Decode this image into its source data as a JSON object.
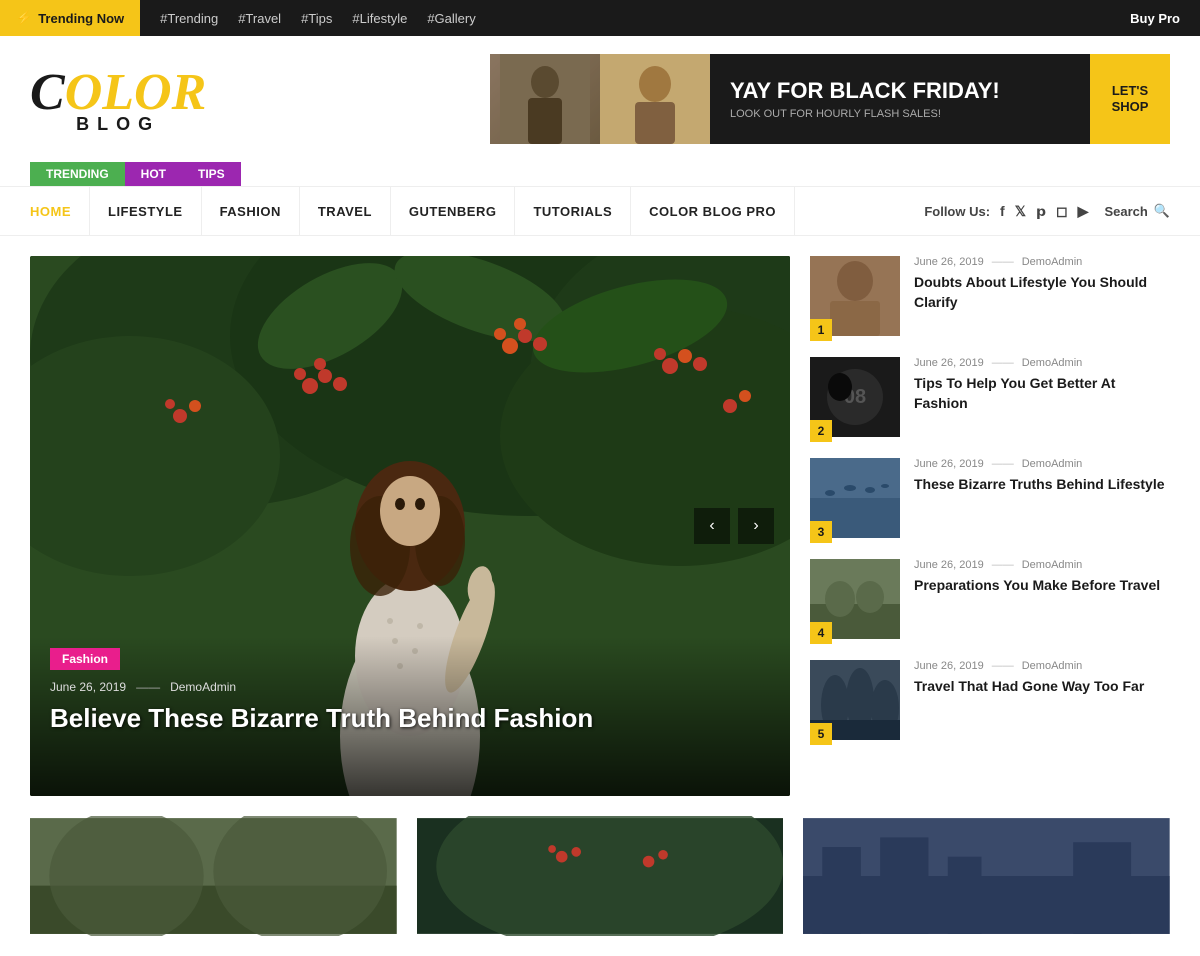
{
  "topbar": {
    "trending_label": "Trending Now",
    "bolt": "⚡",
    "nav_links": [
      {
        "label": "#Trending",
        "href": "#"
      },
      {
        "label": "#Travel",
        "href": "#"
      },
      {
        "label": "#Tips",
        "href": "#"
      },
      {
        "label": "#Lifestyle",
        "href": "#"
      },
      {
        "label": "#Gallery",
        "href": "#"
      }
    ],
    "buy_pro": "Buy Pro"
  },
  "logo": {
    "color_text": "COLOR",
    "blog_text": "BLOG"
  },
  "banner": {
    "headline": "YAY FOR BLACK FRIDAY!",
    "subtext": "LOOK OUT FOR HOURLY FLASH SALES!",
    "cta": "LET'S SHOP"
  },
  "category_tabs": [
    {
      "label": "TRENDING",
      "class": "trending"
    },
    {
      "label": "HOT",
      "class": "hot"
    },
    {
      "label": "TIPS",
      "class": "tips"
    }
  ],
  "nav": {
    "links": [
      {
        "label": "HOME",
        "active": true
      },
      {
        "label": "LIFESTYLE",
        "active": false
      },
      {
        "label": "FASHION",
        "active": false
      },
      {
        "label": "TRAVEL",
        "active": false
      },
      {
        "label": "GUTENBERG",
        "active": false
      },
      {
        "label": "TUTORIALS",
        "active": false
      },
      {
        "label": "COLOR BLOG PRO",
        "active": false
      }
    ],
    "follow_us": "Follow Us:",
    "search": "Search"
  },
  "slider": {
    "category": "Fashion",
    "date": "June 26, 2019",
    "author": "DemoAdmin",
    "title": "Believe These Bizarre Truth Behind Fashion",
    "prev": "‹",
    "next": "›"
  },
  "sidebar_items": [
    {
      "num": "1",
      "date": "June 26, 2019",
      "author": "DemoAdmin",
      "title": "Doubts About Lifestyle You Should Clarify"
    },
    {
      "num": "2",
      "date": "June 26, 2019",
      "author": "DemoAdmin",
      "title": "Tips To Help You Get Better At Fashion"
    },
    {
      "num": "3",
      "date": "June 26, 2019",
      "author": "DemoAdmin",
      "title": "These Bizarre Truths Behind Lifestyle"
    },
    {
      "num": "4",
      "date": "June 26, 2019",
      "author": "DemoAdmin",
      "title": "Preparations You Make Before Travel"
    },
    {
      "num": "5",
      "date": "June 26, 2019",
      "author": "DemoAdmin",
      "title": "Travel That Had Gone Way Too Far"
    }
  ],
  "social_icons": [
    "f",
    "t",
    "p",
    "i",
    "▶"
  ],
  "dash": "——"
}
